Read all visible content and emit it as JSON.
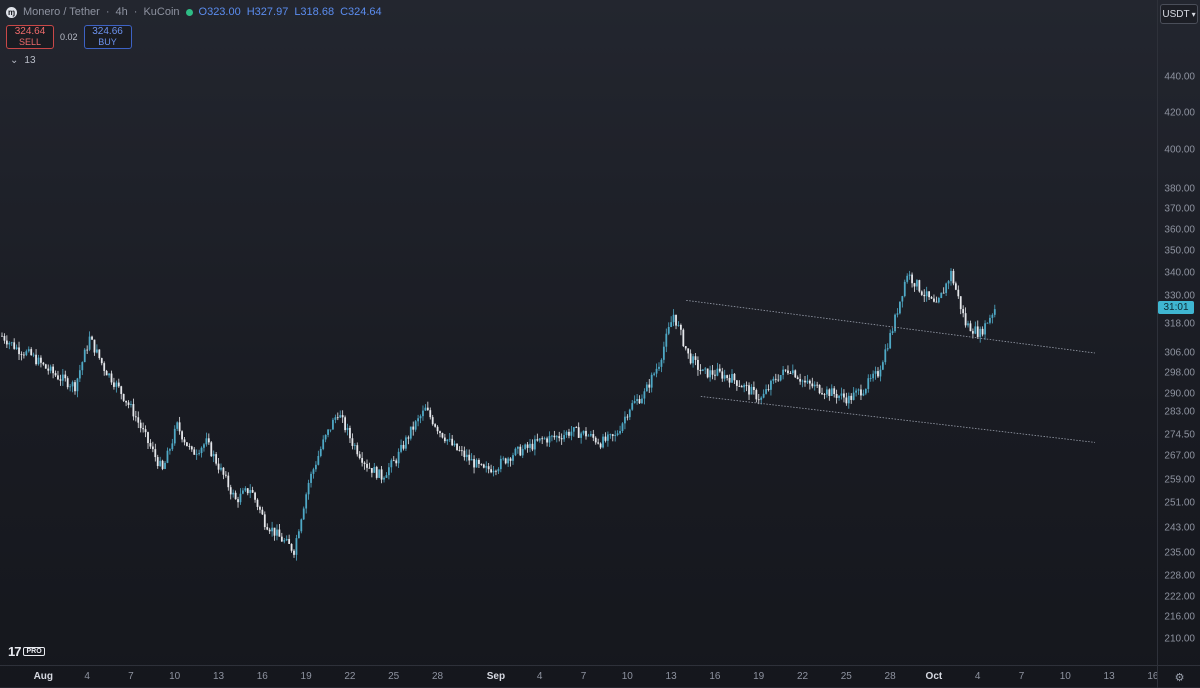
{
  "header": {
    "symbol": "Monero / Tether",
    "interval": "4h",
    "exchange": "KuCoin",
    "open": "O323.00",
    "high": "H327.97",
    "low": "L318.68",
    "close": "C324.64",
    "status_color": "#2ebd85"
  },
  "trade": {
    "sell_price": "324.64",
    "sell_label": "SELL",
    "spread": "0.02",
    "buy_price": "324.66",
    "buy_label": "BUY"
  },
  "indicators_count": "13",
  "currency": "USDT",
  "last_price_label": "31:01",
  "brand": {
    "mark": "17",
    "pro": "PRO"
  },
  "chart_data": {
    "type": "candlestick",
    "scale": "log",
    "ylim": [
      205,
      455
    ],
    "y_ticks": [
      "440.00",
      "420.00",
      "400.00",
      "380.00",
      "370.00",
      "360.00",
      "350.00",
      "340.00",
      "330.00",
      "318.00",
      "306.00",
      "298.00",
      "290.00",
      "283.00",
      "274.50",
      "267.00",
      "259.00",
      "251.00",
      "243.00",
      "235.00",
      "228.00",
      "222.00",
      "216.00",
      "210.00"
    ],
    "x_ticks": [
      {
        "label": "Aug",
        "day": 1,
        "bold": true
      },
      {
        "label": "4",
        "day": 4
      },
      {
        "label": "7",
        "day": 7
      },
      {
        "label": "10",
        "day": 10
      },
      {
        "label": "13",
        "day": 13
      },
      {
        "label": "16",
        "day": 16
      },
      {
        "label": "19",
        "day": 19
      },
      {
        "label": "22",
        "day": 22
      },
      {
        "label": "25",
        "day": 25
      },
      {
        "label": "28",
        "day": 28
      },
      {
        "label": "Sep",
        "day": 32,
        "bold": true
      },
      {
        "label": "4",
        "day": 35
      },
      {
        "label": "7",
        "day": 38
      },
      {
        "label": "10",
        "day": 41
      },
      {
        "label": "13",
        "day": 44
      },
      {
        "label": "16",
        "day": 47
      },
      {
        "label": "19",
        "day": 50
      },
      {
        "label": "22",
        "day": 53
      },
      {
        "label": "25",
        "day": 56
      },
      {
        "label": "28",
        "day": 59
      },
      {
        "label": "Oct",
        "day": 62,
        "bold": true
      },
      {
        "label": "4",
        "day": 65
      },
      {
        "label": "7",
        "day": 68
      },
      {
        "label": "10",
        "day": 71
      },
      {
        "label": "13",
        "day": 74
      },
      {
        "label": "16",
        "day": 77
      }
    ],
    "close_path": [
      [
        0,
        313
      ],
      [
        1,
        308
      ],
      [
        2,
        305
      ],
      [
        3,
        300
      ],
      [
        4,
        296
      ],
      [
        5,
        293
      ],
      [
        6,
        312
      ],
      [
        7,
        300
      ],
      [
        8,
        292
      ],
      [
        9,
        283
      ],
      [
        10,
        272
      ],
      [
        11,
        262
      ],
      [
        12,
        278
      ],
      [
        13,
        268
      ],
      [
        14,
        272
      ],
      [
        15,
        262
      ],
      [
        16,
        252
      ],
      [
        17,
        256
      ],
      [
        18,
        245
      ],
      [
        19,
        240
      ],
      [
        20,
        236
      ],
      [
        21,
        258
      ],
      [
        22,
        272
      ],
      [
        23,
        283
      ],
      [
        24,
        272
      ],
      [
        25,
        264
      ],
      [
        26,
        260
      ],
      [
        27,
        266
      ],
      [
        28,
        276
      ],
      [
        29,
        284
      ],
      [
        30,
        276
      ],
      [
        31,
        270
      ],
      [
        32,
        266
      ],
      [
        33,
        262
      ],
      [
        34,
        264
      ],
      [
        35,
        268
      ],
      [
        36,
        270
      ],
      [
        37,
        273
      ],
      [
        38,
        274
      ],
      [
        39,
        276
      ],
      [
        40,
        275
      ],
      [
        41,
        272
      ],
      [
        42,
        274
      ],
      [
        43,
        285
      ],
      [
        44,
        290
      ],
      [
        45,
        302
      ],
      [
        46,
        322
      ],
      [
        47,
        305
      ],
      [
        48,
        298
      ],
      [
        49,
        298
      ],
      [
        50,
        296
      ],
      [
        51,
        292
      ],
      [
        52,
        288
      ],
      [
        53,
        296
      ],
      [
        54,
        300
      ],
      [
        55,
        294
      ],
      [
        56,
        292
      ],
      [
        57,
        290
      ],
      [
        58,
        288
      ],
      [
        59,
        292
      ],
      [
        60,
        298
      ],
      [
        61,
        316
      ],
      [
        62,
        340
      ],
      [
        63,
        332
      ],
      [
        64,
        325
      ],
      [
        65,
        340
      ],
      [
        66,
        318
      ],
      [
        67,
        314
      ],
      [
        68,
        324.6
      ]
    ],
    "channel": {
      "upper": [
        [
          47,
          328
        ],
        [
          75,
          306
        ]
      ],
      "lower": [
        [
          48,
          289
        ],
        [
          75,
          272
        ]
      ]
    },
    "last_price": 324.64,
    "up_color": "#4fa9c6",
    "down_color": "#e6e8ec",
    "line_color": "#9aa0ad"
  }
}
